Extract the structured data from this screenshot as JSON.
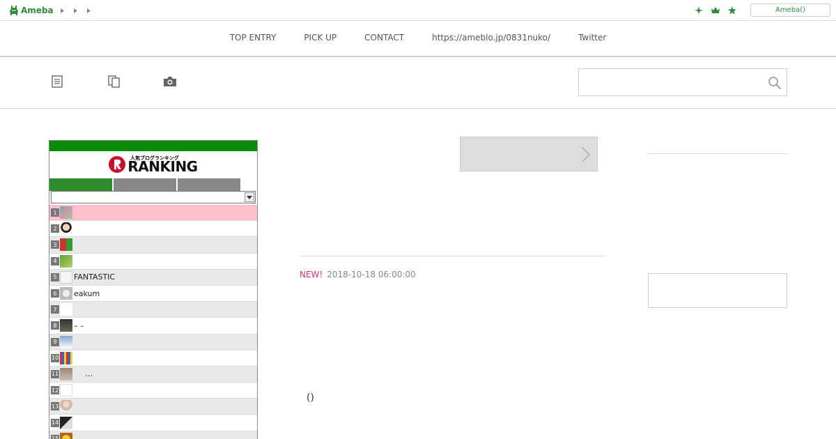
{
  "app": {
    "logo_text": "Ameba",
    "account_button": "Ameba()"
  },
  "topbar": {
    "breadcrumbs": [
      "",
      "",
      ""
    ],
    "icons": [
      "sparkle-icon",
      "crown-icon",
      "star-icon"
    ]
  },
  "nav": {
    "items": [
      {
        "label": "TOP ENTRY"
      },
      {
        "label": "PICK UP"
      },
      {
        "label": "CONTACT"
      },
      {
        "label": "https://ameblo.jp/0831nuko/"
      },
      {
        "label": "Twitter"
      }
    ]
  },
  "toolbar": {
    "icons": [
      "document-icon",
      "copy-icon",
      "camera-icon"
    ],
    "search": {
      "value": "",
      "placeholder": ""
    }
  },
  "ranking": {
    "logo_sub": "人気ブログランキング",
    "logo_text": "RANKING",
    "tabs": [
      "",
      "",
      ""
    ],
    "select_value": "",
    "rows": [
      {
        "rank": "1",
        "title": ""
      },
      {
        "rank": "2",
        "title": ""
      },
      {
        "rank": "3",
        "title": ""
      },
      {
        "rank": "4",
        "title": ""
      },
      {
        "rank": "5",
        "title": "FANTASTIC"
      },
      {
        "rank": "6",
        "title": "eakum"
      },
      {
        "rank": "7",
        "title": ""
      },
      {
        "rank": "8",
        "title": "– –"
      },
      {
        "rank": "9",
        "title": ""
      },
      {
        "rank": "10",
        "title": ""
      },
      {
        "rank": "11",
        "title": "…"
      },
      {
        "rank": "12",
        "title": ""
      },
      {
        "rank": "13",
        "title": ""
      },
      {
        "rank": "14",
        "title": ""
      },
      {
        "rank": "15",
        "title": ""
      }
    ]
  },
  "post": {
    "new_label": "NEW!",
    "date": "2018-10-18 06:00:00",
    "body_text": "()"
  },
  "colors": {
    "brand_green": "#2d8c3c",
    "ranking_green": "#0a8a0a",
    "new_pink": "#d6307b"
  }
}
